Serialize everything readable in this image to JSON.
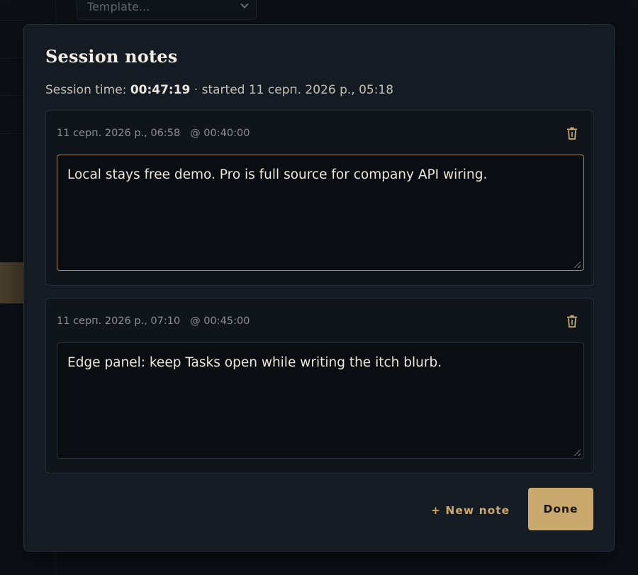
{
  "background": {
    "template_select": {
      "placeholder": "Template..."
    }
  },
  "modal": {
    "title": "Session notes",
    "session_label": "Session time:",
    "session_time": "00:47:19",
    "session_started": " · started 11 серп. 2026 р., 05:18"
  },
  "notes": [
    {
      "date": "11 серп. 2026 р., 06:58",
      "offset": "@ 00:40:00",
      "text": "Local stays free demo. Pro is full source for company API wiring."
    },
    {
      "date": "11 серп. 2026 р., 07:10",
      "offset": "@ 00:45:00",
      "text": "Edge panel: keep Tasks open while writing the itch blurb."
    }
  ],
  "actions": {
    "new_note": "+ New note",
    "done": "Done"
  },
  "colors": {
    "accent": "#c9a96e",
    "modal_bg": "#151b23",
    "card_bg": "#10151b",
    "text": "#ece7de"
  },
  "icons": {
    "delete": "trash-icon",
    "dropdown": "chevron-down-icon"
  }
}
